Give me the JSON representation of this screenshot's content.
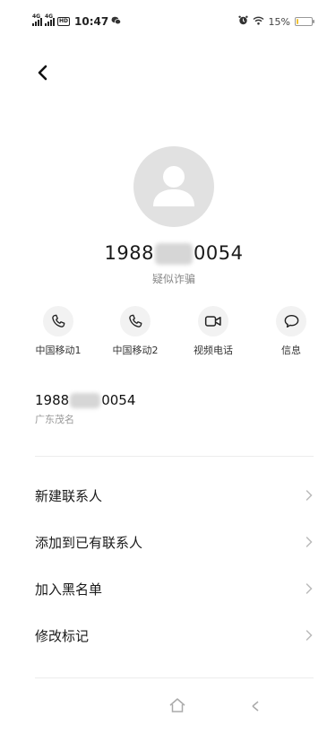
{
  "status_bar": {
    "network1": "4G",
    "network2": "4G",
    "hd": "HD",
    "time": "10:47",
    "battery_text": "15%",
    "battery_level": 0.15,
    "battery_color": "#f1c232"
  },
  "contact": {
    "number_prefix": "1988",
    "number_suffix": "0054",
    "tag": "疑似诈骗",
    "location": "广东茂名"
  },
  "actions": [
    {
      "label": "中国移动1",
      "icon": "phone-icon"
    },
    {
      "label": "中国移动2",
      "icon": "phone-icon"
    },
    {
      "label": "视频电话",
      "icon": "video-camera-icon"
    },
    {
      "label": "信息",
      "icon": "message-bubble-icon"
    }
  ],
  "menu": [
    {
      "label": "新建联系人"
    },
    {
      "label": "添加到已有联系人"
    },
    {
      "label": "加入黑名单"
    },
    {
      "label": "修改标记"
    }
  ],
  "colors": {
    "icon_color": "#222222",
    "circle_bg": "#f2f2f2",
    "avatar_bg": "#e1e1e1"
  }
}
